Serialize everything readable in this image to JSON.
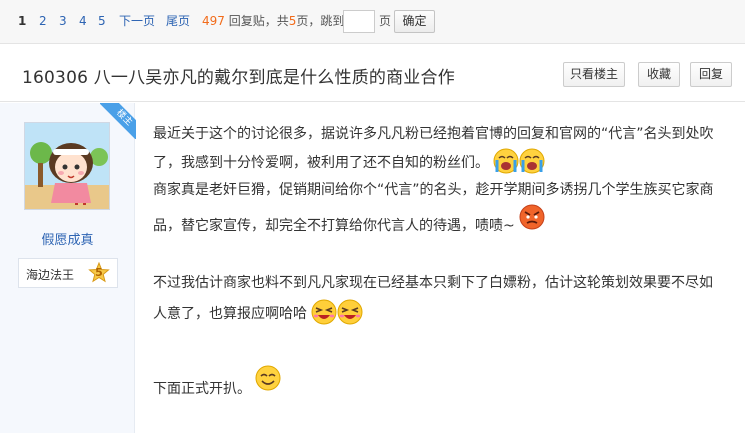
{
  "pager": {
    "pages": [
      "1",
      "2",
      "3",
      "4",
      "5"
    ],
    "current": "1",
    "next_label": "下一页",
    "last_label": "尾页",
    "reply_count": "497",
    "reply_label": "回复贴，共",
    "page_count": "5",
    "page_unit": "页，跳到",
    "page_suffix": "页",
    "jump_value": "",
    "confirm_label": "确定"
  },
  "thread": {
    "title": "160306 八一八吴亦凡的戴尔到底是什么性质的商业合作",
    "buttons": {
      "only_op": "只看楼主",
      "favorite": "收藏",
      "reply": "回复"
    }
  },
  "author": {
    "badge": "楼主",
    "name": "假愿成真",
    "level_name": "海边法王",
    "level": "5"
  },
  "post": {
    "lines": [
      "最近关于这个的讨论很多，据说许多凡凡粉已经抱着官博的回复和官网的“代言”名头到处吹",
      "了，我感到十分怜爱啊，被利用了还不自知的粉丝们。",
      "商家真是老奸巨猾，促销期间给你个“代言”的名头，趁开学期间多诱拐几个学生族买它家商",
      "品，替它家宣传，却完全不打算给你代言人的待遇，啧啧~",
      "不过我估计商家也料不到凡凡家现在已经基本只剩下了白嫖粉，估计这轮策划效果要不尽如",
      "人意了，也算报应啊哈哈",
      "下面正式开扒。"
    ],
    "emoticons": [
      "crying-face",
      "crying-face",
      "angry-face",
      "laughing-face",
      "laughing-face",
      "smiling-face"
    ]
  },
  "colors": {
    "link": "#2d64b3",
    "count": "#f26c1b",
    "ribbon": "#4aa0e8",
    "side_bg": "#f5f8fd"
  }
}
